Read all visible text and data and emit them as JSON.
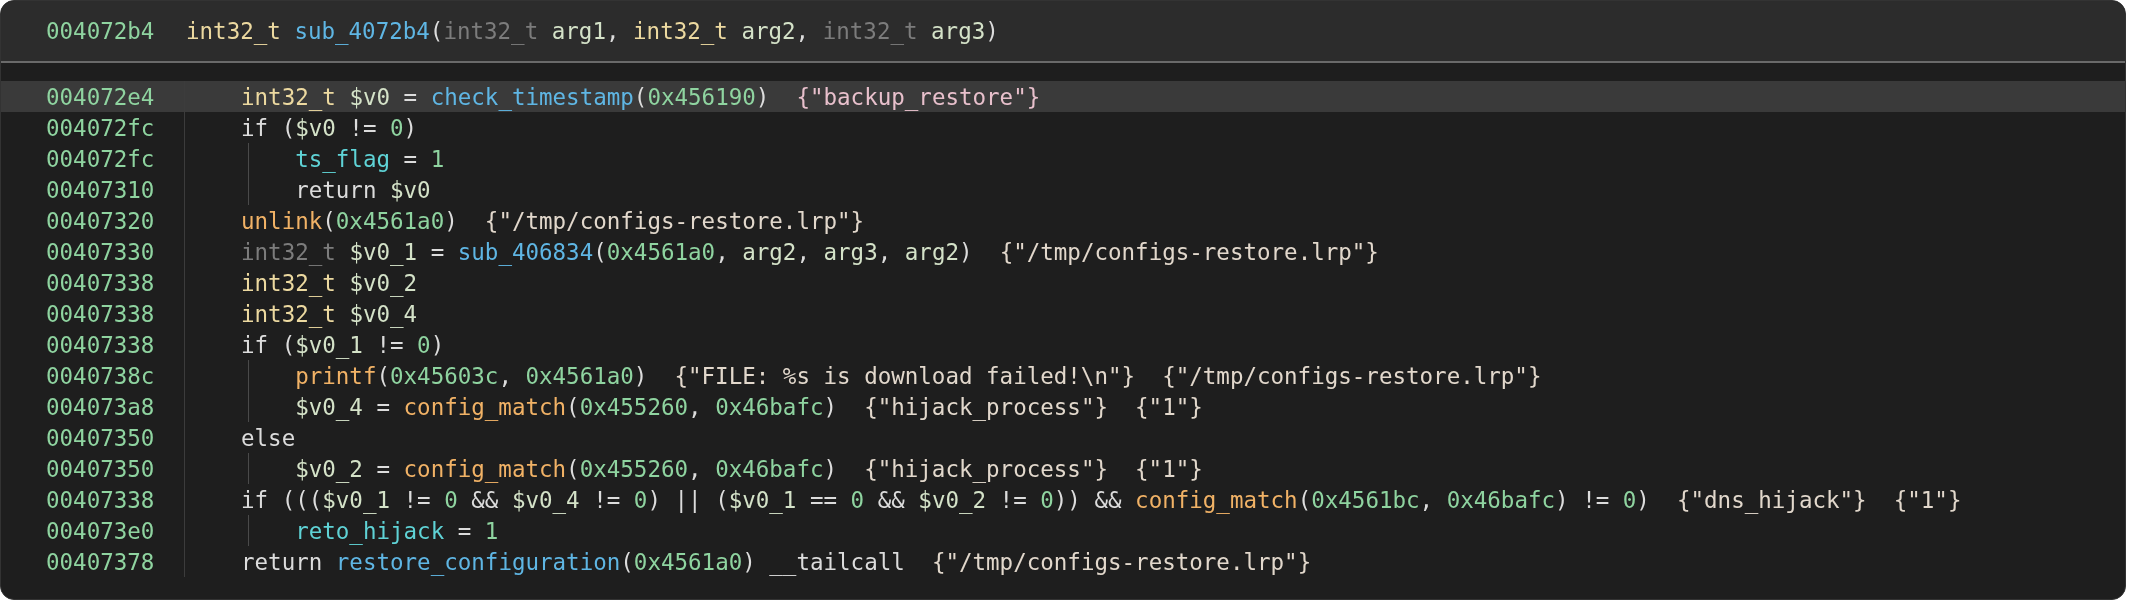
{
  "header": {
    "address": "004072b4",
    "tokens": [
      {
        "kind": "type",
        "text": "int32_t "
      },
      {
        "kind": "func",
        "text": "sub_4072b4"
      },
      {
        "kind": "plain",
        "text": "("
      },
      {
        "kind": "dimtype",
        "text": "int32_t "
      },
      {
        "kind": "var",
        "text": "arg1"
      },
      {
        "kind": "plain",
        "text": ", "
      },
      {
        "kind": "type",
        "text": "int32_t "
      },
      {
        "kind": "var",
        "text": "arg2"
      },
      {
        "kind": "plain",
        "text": ", "
      },
      {
        "kind": "dimtype",
        "text": "int32_t "
      },
      {
        "kind": "var",
        "text": "arg3"
      },
      {
        "kind": "plain",
        "text": ")"
      }
    ]
  },
  "lines": [
    {
      "address": "004072e4",
      "selected": true,
      "tokens": [
        {
          "kind": "type",
          "text": "int32_t "
        },
        {
          "kind": "var",
          "text": "$v0"
        },
        {
          "kind": "plain",
          "text": " = "
        },
        {
          "kind": "func",
          "text": "check_timestamp"
        },
        {
          "kind": "plain",
          "text": "("
        },
        {
          "kind": "num",
          "text": "0x456190"
        },
        {
          "kind": "plain",
          "text": ")  "
        },
        {
          "kind": "strpink",
          "text": "{\"backup_restore\"}"
        }
      ]
    },
    {
      "address": "004072fc",
      "selected": false,
      "tokens": [
        {
          "kind": "plain",
          "text": "if ("
        },
        {
          "kind": "var",
          "text": "$v0"
        },
        {
          "kind": "plain",
          "text": " != "
        },
        {
          "kind": "num",
          "text": "0"
        },
        {
          "kind": "plain",
          "text": ")"
        }
      ],
      "children": [
        {
          "address": "004072fc",
          "selected": false,
          "tokens": [
            {
              "kind": "global",
              "text": "ts_flag"
            },
            {
              "kind": "plain",
              "text": " = "
            },
            {
              "kind": "num",
              "text": "1"
            }
          ]
        },
        {
          "address": "00407310",
          "selected": false,
          "tokens": [
            {
              "kind": "plain",
              "text": "return "
            },
            {
              "kind": "var",
              "text": "$v0"
            }
          ]
        }
      ]
    },
    {
      "address": "00407320",
      "selected": false,
      "tokens": [
        {
          "kind": "import",
          "text": "unlink"
        },
        {
          "kind": "plain",
          "text": "("
        },
        {
          "kind": "num",
          "text": "0x4561a0"
        },
        {
          "kind": "plain",
          "text": ")  "
        },
        {
          "kind": "str",
          "text": "{\"/tmp/configs-restore.lrp\"}"
        }
      ]
    },
    {
      "address": "00407330",
      "selected": false,
      "tokens": [
        {
          "kind": "dimtype",
          "text": "int32_t "
        },
        {
          "kind": "var",
          "text": "$v0_1"
        },
        {
          "kind": "plain",
          "text": " = "
        },
        {
          "kind": "func",
          "text": "sub_406834"
        },
        {
          "kind": "plain",
          "text": "("
        },
        {
          "kind": "num",
          "text": "0x4561a0"
        },
        {
          "kind": "plain",
          "text": ", "
        },
        {
          "kind": "var",
          "text": "arg2"
        },
        {
          "kind": "plain",
          "text": ", "
        },
        {
          "kind": "var",
          "text": "arg3"
        },
        {
          "kind": "plain",
          "text": ", "
        },
        {
          "kind": "var",
          "text": "arg2"
        },
        {
          "kind": "plain",
          "text": ")  "
        },
        {
          "kind": "str",
          "text": "{\"/tmp/configs-restore.lrp\"}"
        }
      ]
    },
    {
      "address": "00407338",
      "selected": false,
      "tokens": [
        {
          "kind": "type",
          "text": "int32_t "
        },
        {
          "kind": "var",
          "text": "$v0_2"
        }
      ]
    },
    {
      "address": "00407338",
      "selected": false,
      "tokens": [
        {
          "kind": "type",
          "text": "int32_t "
        },
        {
          "kind": "var",
          "text": "$v0_4"
        }
      ]
    },
    {
      "address": "00407338",
      "selected": false,
      "tokens": [
        {
          "kind": "plain",
          "text": "if ("
        },
        {
          "kind": "var",
          "text": "$v0_1"
        },
        {
          "kind": "plain",
          "text": " != "
        },
        {
          "kind": "num",
          "text": "0"
        },
        {
          "kind": "plain",
          "text": ")"
        }
      ],
      "children": [
        {
          "address": "0040738c",
          "selected": false,
          "tokens": [
            {
              "kind": "import",
              "text": "printf"
            },
            {
              "kind": "plain",
              "text": "("
            },
            {
              "kind": "num",
              "text": "0x45603c"
            },
            {
              "kind": "plain",
              "text": ", "
            },
            {
              "kind": "num",
              "text": "0x4561a0"
            },
            {
              "kind": "plain",
              "text": ")  "
            },
            {
              "kind": "str",
              "text": "{\"FILE: %s is download failed!\\n\"}  "
            },
            {
              "kind": "str",
              "text": "{\"/tmp/configs-restore.lrp\"}"
            }
          ]
        },
        {
          "address": "004073a8",
          "selected": false,
          "tokens": [
            {
              "kind": "var",
              "text": "$v0_4"
            },
            {
              "kind": "plain",
              "text": " = "
            },
            {
              "kind": "import",
              "text": "config_match"
            },
            {
              "kind": "plain",
              "text": "("
            },
            {
              "kind": "num",
              "text": "0x455260"
            },
            {
              "kind": "plain",
              "text": ", "
            },
            {
              "kind": "num",
              "text": "0x46bafc"
            },
            {
              "kind": "plain",
              "text": ")  "
            },
            {
              "kind": "str",
              "text": "{\"hijack_process\"}  "
            },
            {
              "kind": "str",
              "text": "{\"1\"}"
            }
          ]
        }
      ]
    },
    {
      "address": "00407350",
      "selected": false,
      "tokens": [
        {
          "kind": "plain",
          "text": "else"
        }
      ],
      "children": [
        {
          "address": "00407350",
          "selected": false,
          "tokens": [
            {
              "kind": "var",
              "text": "$v0_2"
            },
            {
              "kind": "plain",
              "text": " = "
            },
            {
              "kind": "import",
              "text": "config_match"
            },
            {
              "kind": "plain",
              "text": "("
            },
            {
              "kind": "num",
              "text": "0x455260"
            },
            {
              "kind": "plain",
              "text": ", "
            },
            {
              "kind": "num",
              "text": "0x46bafc"
            },
            {
              "kind": "plain",
              "text": ")  "
            },
            {
              "kind": "str",
              "text": "{\"hijack_process\"}  "
            },
            {
              "kind": "str",
              "text": "{\"1\"}"
            }
          ]
        }
      ]
    },
    {
      "address": "00407338",
      "selected": false,
      "tokens": [
        {
          "kind": "plain",
          "text": "if ((("
        },
        {
          "kind": "var",
          "text": "$v0_1"
        },
        {
          "kind": "plain",
          "text": " != "
        },
        {
          "kind": "num",
          "text": "0"
        },
        {
          "kind": "plain",
          "text": " && "
        },
        {
          "kind": "var",
          "text": "$v0_4"
        },
        {
          "kind": "plain",
          "text": " != "
        },
        {
          "kind": "num",
          "text": "0"
        },
        {
          "kind": "plain",
          "text": ") || ("
        },
        {
          "kind": "var",
          "text": "$v0_1"
        },
        {
          "kind": "plain",
          "text": " == "
        },
        {
          "kind": "num",
          "text": "0"
        },
        {
          "kind": "plain",
          "text": " && "
        },
        {
          "kind": "var",
          "text": "$v0_2"
        },
        {
          "kind": "plain",
          "text": " != "
        },
        {
          "kind": "num",
          "text": "0"
        },
        {
          "kind": "plain",
          "text": ")) && "
        },
        {
          "kind": "import",
          "text": "config_match"
        },
        {
          "kind": "plain",
          "text": "("
        },
        {
          "kind": "num",
          "text": "0x4561bc"
        },
        {
          "kind": "plain",
          "text": ", "
        },
        {
          "kind": "num",
          "text": "0x46bafc"
        },
        {
          "kind": "plain",
          "text": ") != "
        },
        {
          "kind": "num",
          "text": "0"
        },
        {
          "kind": "plain",
          "text": ")  "
        },
        {
          "kind": "str",
          "text": "{\"dns_hijack\"}  "
        },
        {
          "kind": "str",
          "text": "{\"1\"}"
        }
      ],
      "children": [
        {
          "address": "004073e0",
          "selected": false,
          "tokens": [
            {
              "kind": "global",
              "text": "reto_hijack"
            },
            {
              "kind": "plain",
              "text": " = "
            },
            {
              "kind": "num",
              "text": "1"
            }
          ]
        }
      ]
    },
    {
      "address": "00407378",
      "selected": false,
      "tokens": [
        {
          "kind": "plain",
          "text": "return "
        },
        {
          "kind": "func",
          "text": "restore_configuration"
        },
        {
          "kind": "plain",
          "text": "("
        },
        {
          "kind": "num",
          "text": "0x4561a0"
        },
        {
          "kind": "plain",
          "text": ") __tailcall  "
        },
        {
          "kind": "str",
          "text": "{\"/tmp/configs-restore.lrp\"}"
        }
      ]
    }
  ]
}
